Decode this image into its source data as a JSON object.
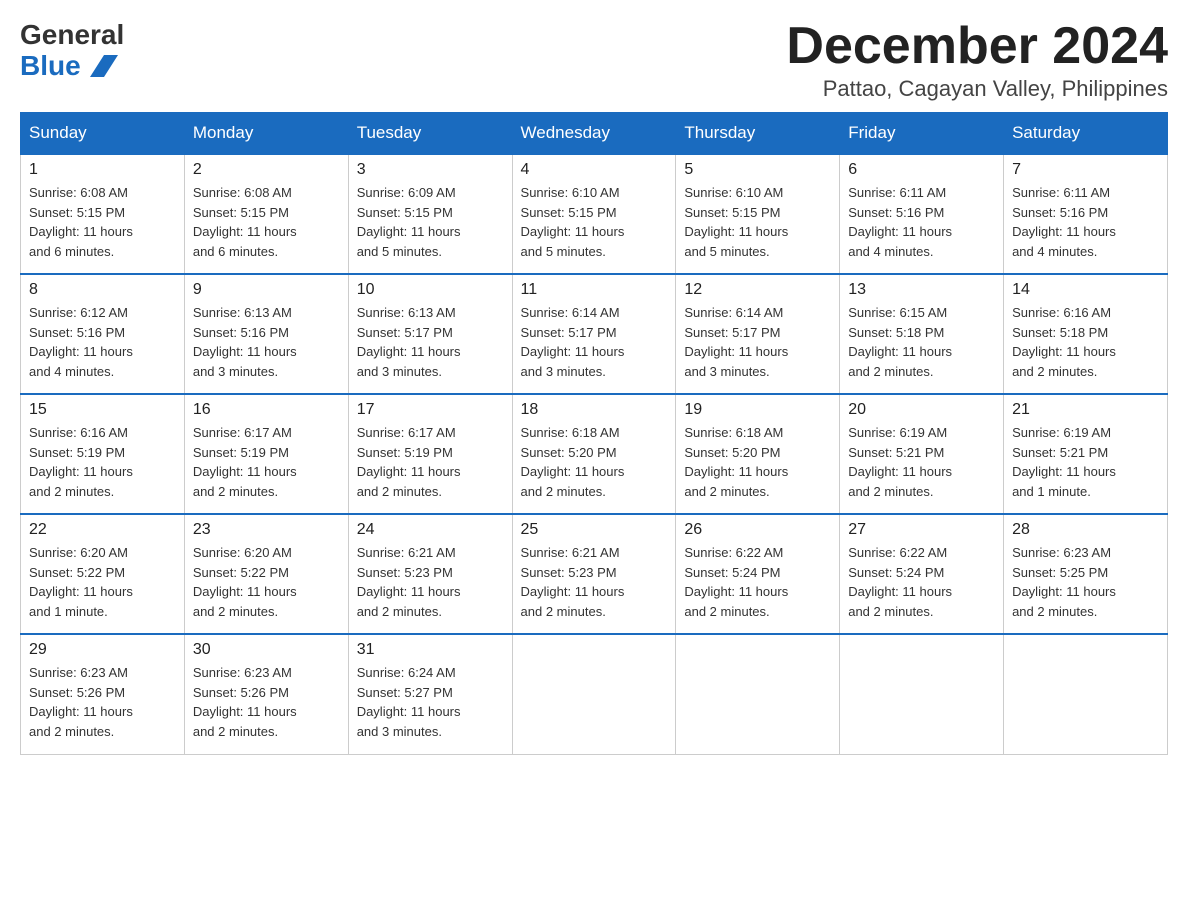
{
  "header": {
    "logo_general": "General",
    "logo_blue": "Blue",
    "month_title": "December 2024",
    "location": "Pattao, Cagayan Valley, Philippines"
  },
  "weekdays": [
    "Sunday",
    "Monday",
    "Tuesday",
    "Wednesday",
    "Thursday",
    "Friday",
    "Saturday"
  ],
  "weeks": [
    [
      {
        "day": "1",
        "sunrise": "6:08 AM",
        "sunset": "5:15 PM",
        "daylight": "11 hours and 6 minutes."
      },
      {
        "day": "2",
        "sunrise": "6:08 AM",
        "sunset": "5:15 PM",
        "daylight": "11 hours and 6 minutes."
      },
      {
        "day": "3",
        "sunrise": "6:09 AM",
        "sunset": "5:15 PM",
        "daylight": "11 hours and 5 minutes."
      },
      {
        "day": "4",
        "sunrise": "6:10 AM",
        "sunset": "5:15 PM",
        "daylight": "11 hours and 5 minutes."
      },
      {
        "day": "5",
        "sunrise": "6:10 AM",
        "sunset": "5:15 PM",
        "daylight": "11 hours and 5 minutes."
      },
      {
        "day": "6",
        "sunrise": "6:11 AM",
        "sunset": "5:16 PM",
        "daylight": "11 hours and 4 minutes."
      },
      {
        "day": "7",
        "sunrise": "6:11 AM",
        "sunset": "5:16 PM",
        "daylight": "11 hours and 4 minutes."
      }
    ],
    [
      {
        "day": "8",
        "sunrise": "6:12 AM",
        "sunset": "5:16 PM",
        "daylight": "11 hours and 4 minutes."
      },
      {
        "day": "9",
        "sunrise": "6:13 AM",
        "sunset": "5:16 PM",
        "daylight": "11 hours and 3 minutes."
      },
      {
        "day": "10",
        "sunrise": "6:13 AM",
        "sunset": "5:17 PM",
        "daylight": "11 hours and 3 minutes."
      },
      {
        "day": "11",
        "sunrise": "6:14 AM",
        "sunset": "5:17 PM",
        "daylight": "11 hours and 3 minutes."
      },
      {
        "day": "12",
        "sunrise": "6:14 AM",
        "sunset": "5:17 PM",
        "daylight": "11 hours and 3 minutes."
      },
      {
        "day": "13",
        "sunrise": "6:15 AM",
        "sunset": "5:18 PM",
        "daylight": "11 hours and 2 minutes."
      },
      {
        "day": "14",
        "sunrise": "6:16 AM",
        "sunset": "5:18 PM",
        "daylight": "11 hours and 2 minutes."
      }
    ],
    [
      {
        "day": "15",
        "sunrise": "6:16 AM",
        "sunset": "5:19 PM",
        "daylight": "11 hours and 2 minutes."
      },
      {
        "day": "16",
        "sunrise": "6:17 AM",
        "sunset": "5:19 PM",
        "daylight": "11 hours and 2 minutes."
      },
      {
        "day": "17",
        "sunrise": "6:17 AM",
        "sunset": "5:19 PM",
        "daylight": "11 hours and 2 minutes."
      },
      {
        "day": "18",
        "sunrise": "6:18 AM",
        "sunset": "5:20 PM",
        "daylight": "11 hours and 2 minutes."
      },
      {
        "day": "19",
        "sunrise": "6:18 AM",
        "sunset": "5:20 PM",
        "daylight": "11 hours and 2 minutes."
      },
      {
        "day": "20",
        "sunrise": "6:19 AM",
        "sunset": "5:21 PM",
        "daylight": "11 hours and 2 minutes."
      },
      {
        "day": "21",
        "sunrise": "6:19 AM",
        "sunset": "5:21 PM",
        "daylight": "11 hours and 1 minute."
      }
    ],
    [
      {
        "day": "22",
        "sunrise": "6:20 AM",
        "sunset": "5:22 PM",
        "daylight": "11 hours and 1 minute."
      },
      {
        "day": "23",
        "sunrise": "6:20 AM",
        "sunset": "5:22 PM",
        "daylight": "11 hours and 2 minutes."
      },
      {
        "day": "24",
        "sunrise": "6:21 AM",
        "sunset": "5:23 PM",
        "daylight": "11 hours and 2 minutes."
      },
      {
        "day": "25",
        "sunrise": "6:21 AM",
        "sunset": "5:23 PM",
        "daylight": "11 hours and 2 minutes."
      },
      {
        "day": "26",
        "sunrise": "6:22 AM",
        "sunset": "5:24 PM",
        "daylight": "11 hours and 2 minutes."
      },
      {
        "day": "27",
        "sunrise": "6:22 AM",
        "sunset": "5:24 PM",
        "daylight": "11 hours and 2 minutes."
      },
      {
        "day": "28",
        "sunrise": "6:23 AM",
        "sunset": "5:25 PM",
        "daylight": "11 hours and 2 minutes."
      }
    ],
    [
      {
        "day": "29",
        "sunrise": "6:23 AM",
        "sunset": "5:26 PM",
        "daylight": "11 hours and 2 minutes."
      },
      {
        "day": "30",
        "sunrise": "6:23 AM",
        "sunset": "5:26 PM",
        "daylight": "11 hours and 2 minutes."
      },
      {
        "day": "31",
        "sunrise": "6:24 AM",
        "sunset": "5:27 PM",
        "daylight": "11 hours and 3 minutes."
      },
      null,
      null,
      null,
      null
    ]
  ],
  "labels": {
    "sunrise": "Sunrise:",
    "sunset": "Sunset:",
    "daylight": "Daylight:"
  }
}
